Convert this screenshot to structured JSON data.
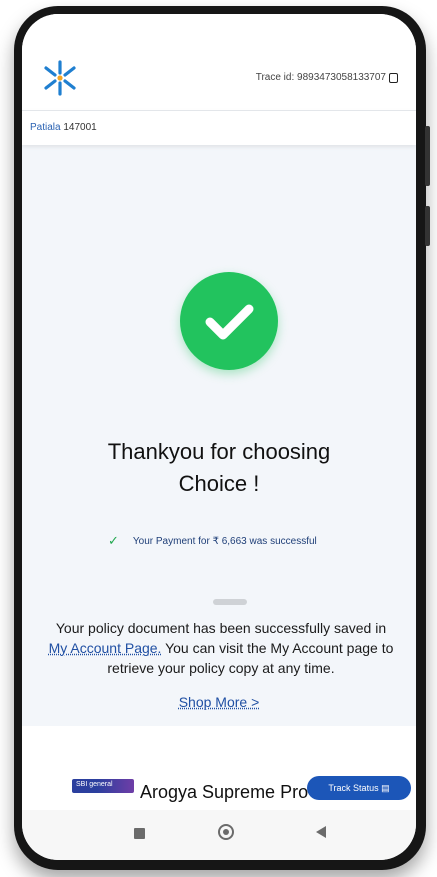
{
  "header": {
    "trace_label": "Trace id: 9893473058133707",
    "location_city": "Patiala",
    "location_pin": "147001"
  },
  "success": {
    "title_line1": "Thankyou for choosing",
    "title_line2": "Choice !",
    "payment_message": "Your Payment for ₹ 6,663 was successful"
  },
  "policy": {
    "text_before": "Your policy document has been successfully saved in",
    "link_text": "My Account Page.",
    "text_after": " You can visit the My Account page to retrieve your policy copy at any time."
  },
  "shop_more_label": "Shop More >",
  "product": {
    "brand_logo_text": "SBI general",
    "name": "Arogya Supreme Pro",
    "track_label": "Track Status"
  },
  "colors": {
    "success_green": "#22c35e",
    "link_blue": "#1f4fa3",
    "button_blue": "#1c56b8"
  },
  "icons": [
    "logo-icon",
    "copy-icon",
    "check-icon",
    "tick-icon",
    "track-icon",
    "recents-icon",
    "home-icon",
    "back-icon"
  ]
}
